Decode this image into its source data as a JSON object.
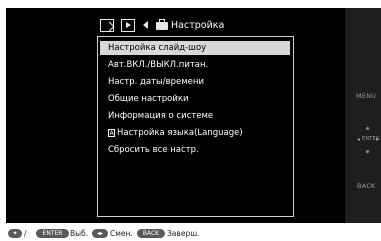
{
  "header": {
    "title": "Настройка",
    "tab_icons": [
      "slideshow-tab-icon",
      "playback-tab-icon"
    ]
  },
  "menu": {
    "items": [
      {
        "label": "Настройка слайд-шоу",
        "selected": true
      },
      {
        "label": "Авт.ВКЛ./ВЫКЛ.питан.",
        "selected": false
      },
      {
        "label": "Настр. даты/времени",
        "selected": false
      },
      {
        "label": "Общие настройки",
        "selected": false
      },
      {
        "label": "Информация о системе",
        "selected": false
      },
      {
        "label": "Настройка языка(Language)",
        "selected": false,
        "icon": "language-icon"
      },
      {
        "label": "Сбросить все настр.",
        "selected": false
      }
    ]
  },
  "side_buttons": {
    "menu": "MENU",
    "enter": "ENTER",
    "back": "BACK"
  },
  "footer": {
    "enter_chip": "ENTER",
    "select_text": "Выб.",
    "change_text": "Смен.",
    "back_chip": "BACK",
    "finish_text": "Заверш.",
    "separator": "/"
  },
  "colors": {
    "screen_bg": "#000000",
    "text": "#ffffff",
    "selection_bg": "#d8d8d8",
    "panel_border": "#cfcfcf"
  }
}
